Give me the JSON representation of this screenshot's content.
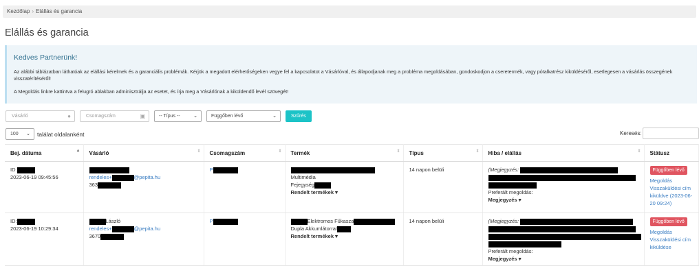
{
  "breadcrumb": {
    "home": "Kezdőlap",
    "separator": "›",
    "current": "Elállás és garancia"
  },
  "page_title": "Elállás és garancia",
  "alert": {
    "heading": "Kedves Partnerünk!",
    "text1": "Az alábbi táblázatban láthatóak az elállási kérelmek és a garanciális problémák. Kérjük a megadott elérhetőségeken vegye fel a kapcsolatot a Vásárlóval, és állapodjanak meg a probléma megoldásában, gondoskodjon a cseretermék, vagy pótalkatrész kiküldéséről, esetlegesen a vásárlás összegének visszatérítéséről!",
    "text2": "A Megoldás linkre kattintva a felugró ablakban adminisztrálja az esetet, és írja meg a Vásárlónak a kiküldendő levél szövegét!"
  },
  "filters": {
    "buyer_placeholder": "Vásárló",
    "package_placeholder": "Csomagszám",
    "type_select": "-- Típus --",
    "status_select": "Függőben lévő",
    "filter_button": "Szűrés"
  },
  "paging": {
    "page_size": "100",
    "label": "találat oldalanként"
  },
  "search": {
    "label": "Keresés:"
  },
  "columns": [
    "Bej. dátuma",
    "Vásárló",
    "Csomagszám",
    "Termék",
    "Típus",
    "Hiba / elállás",
    "Státusz"
  ],
  "rows": [
    {
      "id_prefix": "ID:",
      "date": "2023-06-19 09:45:56",
      "email_prefix": "rendeles+",
      "email_suffix": "@pepita.hu",
      "zip_prefix": "363",
      "package_prefix": "P",
      "product_suffix": "Multimédia",
      "product_line2": "Fejegység",
      "ordered_products": "Rendelt termékek",
      "type": "14 napon belüli",
      "note_label": "(Megjegyzés:",
      "preferred": "Preferált megoldás:",
      "note_toggle": "Megjegyzés",
      "status": "Függőben lévő",
      "status_link": "Megoldás",
      "status_sub": "Visszaküldési cím kiküldve (2023-06-20 09:24)"
    },
    {
      "id_prefix": "ID:",
      "date": "2023-06-19 10:29:34",
      "name_suffix": "László",
      "email_prefix": "rendeles+",
      "email_suffix": "@pepita.hu",
      "zip_prefix": "3670",
      "package_prefix": "P",
      "product_suffix": "Elektromos Fűkasza",
      "product_line2": "Dupla Akkumlátorral",
      "ordered_products": "Rendelt termékek",
      "type": "14 napon belüli",
      "note_label": "(Megjegyzés:",
      "preferred": "Preferált megoldás:",
      "note_toggle": "Megjegyzés",
      "status": "Függőben lévő",
      "status_link": "Megoldás",
      "status_sub": "Visszaküldési cím kiküldése"
    }
  ],
  "colors": {
    "accent": "#1cc3c7",
    "badge": "#e05560",
    "link": "#3a7dc2",
    "alert_bg": "#eef5f9"
  }
}
